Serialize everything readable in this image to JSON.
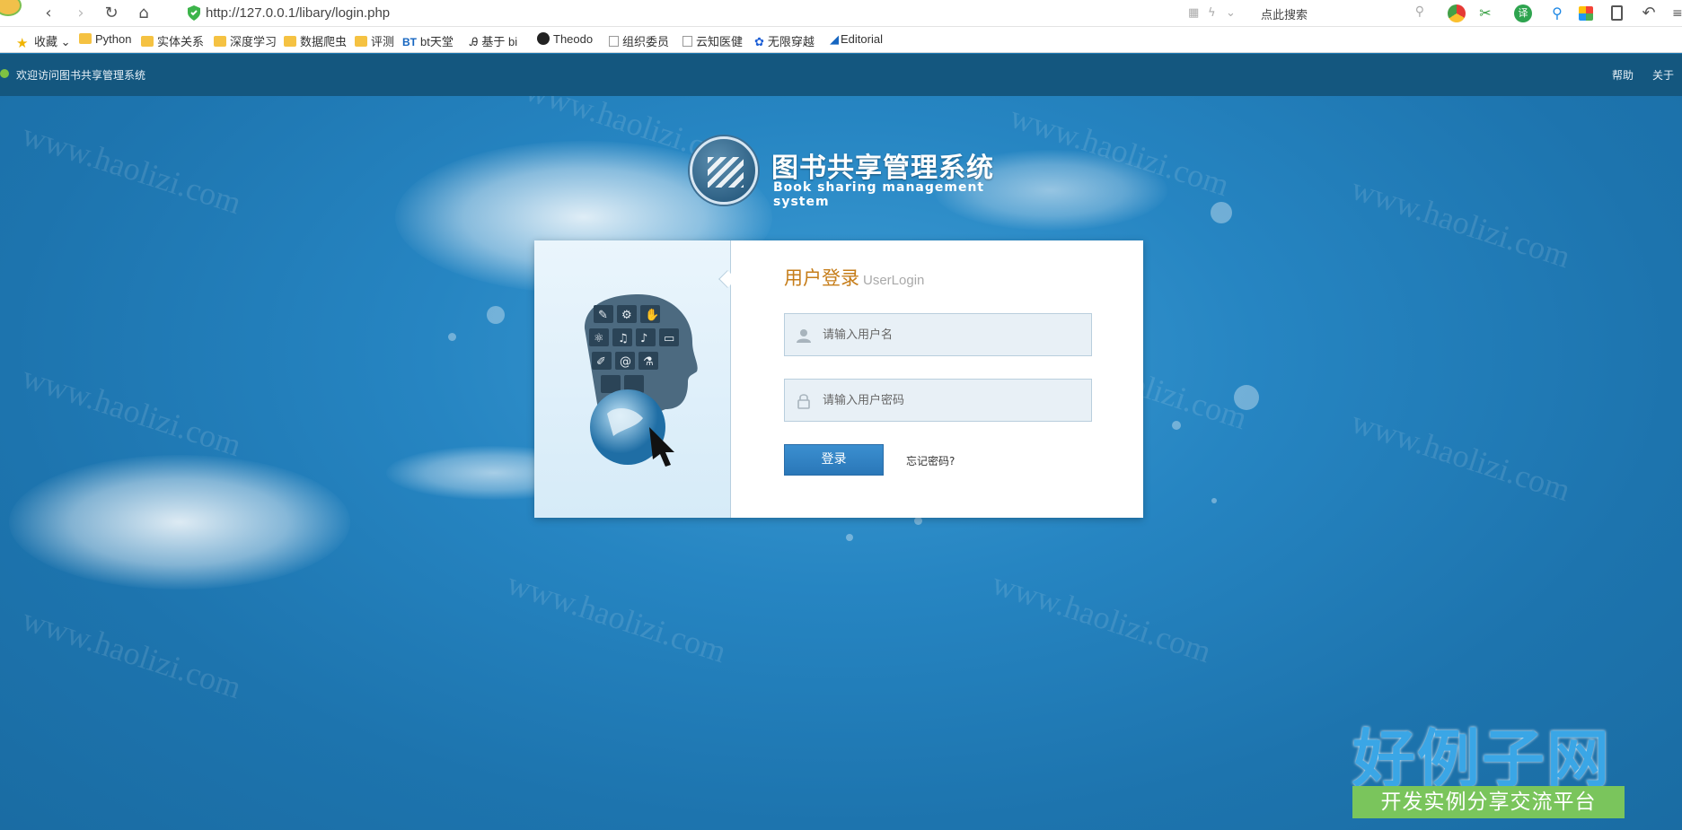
{
  "browser": {
    "url": "http://127.0.0.1/libary/login.php",
    "search_placeholder": "点此搜索",
    "bookmarks": [
      {
        "label": "收藏",
        "type": "star"
      },
      {
        "label": "Python",
        "type": "folder"
      },
      {
        "label": "实体关系",
        "type": "folder"
      },
      {
        "label": "深度学习",
        "type": "folder"
      },
      {
        "label": "数据爬虫",
        "type": "folder"
      },
      {
        "label": "评测",
        "type": "folder"
      },
      {
        "label": "bt天堂",
        "type": "bt"
      },
      {
        "label": "基于 bi",
        "type": "link"
      },
      {
        "label": "Theodo",
        "type": "github"
      },
      {
        "label": "组织委员",
        "type": "page"
      },
      {
        "label": "云知医健",
        "type": "page"
      },
      {
        "label": "无限穿越",
        "type": "paw"
      },
      {
        "label": "Editorial",
        "type": "link"
      }
    ]
  },
  "site_header": {
    "welcome": "欢迎访问图书共享管理系统",
    "help": "帮助",
    "about": "关于"
  },
  "logo": {
    "title_cn": "图书共享管理系统",
    "title_en": "Book sharing management system"
  },
  "login": {
    "title": "用户登录",
    "title_en": "UserLogin",
    "username_placeholder": "请输入用户名",
    "password_placeholder": "请输入用户密码",
    "submit": "登录",
    "forgot": "忘记密码?"
  },
  "watermark": {
    "text": "www.haolizi.com",
    "brand_big": "好例子网",
    "brand_tagline": "开发实例分享交流平台"
  },
  "colors": {
    "header_bg": "#14577f",
    "page_bg": "#1f79b4",
    "title_orange": "#c67d19",
    "button_blue": "#2a77b8",
    "brand_green": "#7ac55c"
  }
}
